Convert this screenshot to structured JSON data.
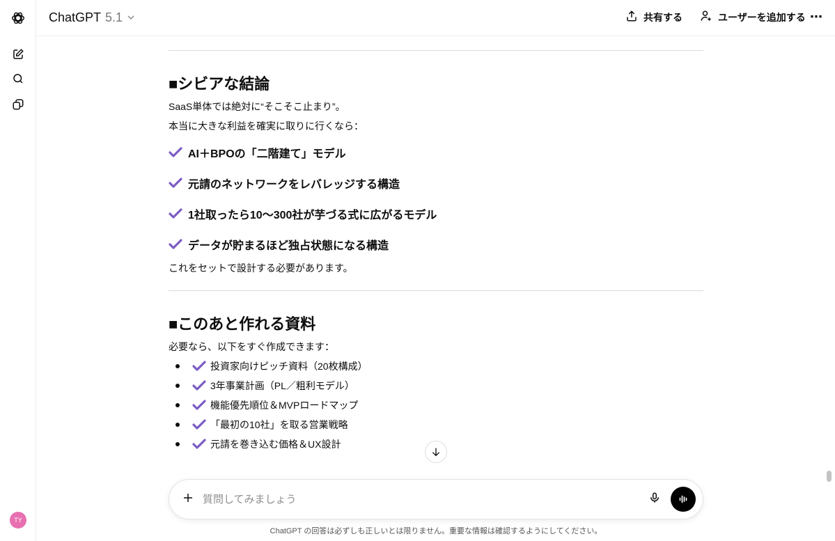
{
  "header": {
    "title": "ChatGPT",
    "version": "5.1",
    "share": "共有する",
    "add_user": "ユーザーを追加する"
  },
  "sidebar": {
    "avatar": "TY"
  },
  "sections": [
    {
      "heading": "■シビアな結論",
      "lines": [
        "SaaS単体では絶対に“そこそこ止まり”。",
        "本当に大きな利益を確実に取りに行くなら："
      ],
      "items": [
        "AI＋BPOの「二階建て」モデル",
        "元請のネットワークをレバレッジする構造",
        "1社取ったら10〜300社が芋づる式に広がるモデル",
        "データが貯まるほど独占状態になる構造"
      ],
      "closing": "これをセットで設計する必要があります。"
    },
    {
      "heading": "■このあと作れる資料",
      "lines": [
        "必要なら、以下をすぐ作成できます："
      ],
      "items": [
        "投資家向けピッチ資料（20枚構成）",
        "3年事業計画（PL／粗利モデル）",
        "機能優先順位＆MVPロードマップ",
        "「最初の10社」を取る営業戦略",
        "元請を巻き込む価格＆UX設計"
      ]
    }
  ],
  "composer": {
    "placeholder": "質問してみましょう"
  },
  "footer": "ChatGPT の回答は必ずしも正しいとは限りません。重要な情報は確認するようにしてください。",
  "colors": {
    "check": "#7b5cc4",
    "accent": "#000000"
  }
}
